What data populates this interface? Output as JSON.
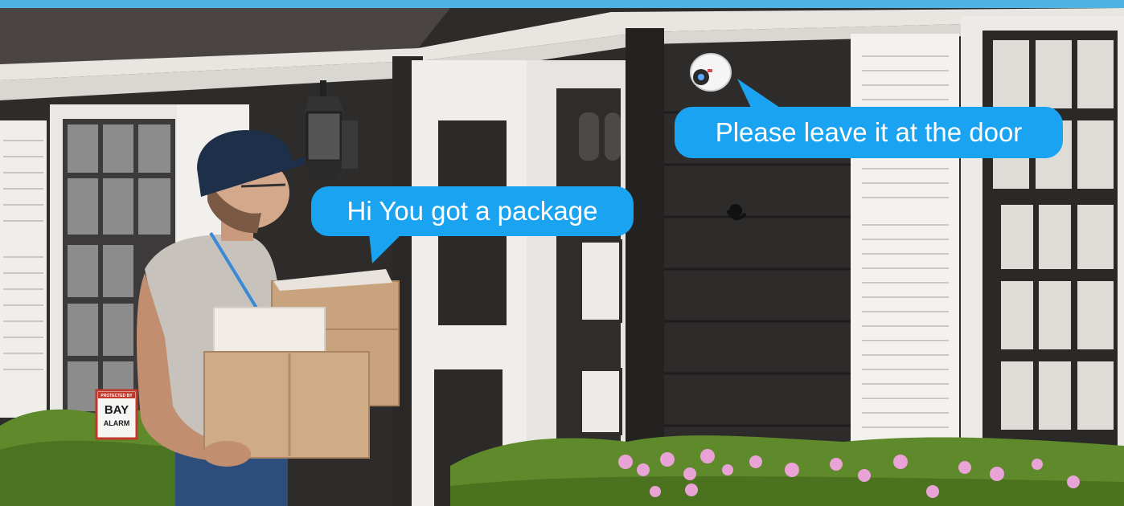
{
  "scene": {
    "subject": "delivery-at-front-door",
    "colors": {
      "speech_bubble": "#1aa3f0",
      "speech_text": "#ffffff",
      "siding": "#2e2c2b",
      "trim": "#ecebe7",
      "shutter": "#f2f1ee",
      "hedge": "#5f8a2b",
      "flowers": "#e9a3d6"
    }
  },
  "bubbles": {
    "courier": "Hi You got a package",
    "camera": "Please leave it at the door"
  },
  "yard_sign": {
    "line1": "PROTECTED BY",
    "brand_line1": "BAY",
    "brand_line2": "ALARM"
  }
}
